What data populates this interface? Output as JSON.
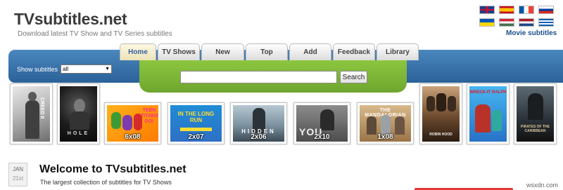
{
  "header": {
    "site_name": "TVsubtitles.net",
    "tagline": "Download latest TV Show and TV Series subtitles",
    "movie_subtitles_link": "Movie subtitles"
  },
  "flags": [
    {
      "name": "uk-flag-icon"
    },
    {
      "name": "spain-flag-icon"
    },
    {
      "name": "france-flag-icon"
    },
    {
      "name": "russia-flag-icon"
    },
    {
      "name": "ukraine-flag-icon"
    },
    {
      "name": "hungary-flag-icon"
    },
    {
      "name": "netherlands-flag-icon"
    },
    {
      "name": "greece-flag-icon"
    }
  ],
  "nav": {
    "tabs": [
      "Home",
      "TV Shows",
      "New",
      "Top",
      "Add",
      "Feedback",
      "Library"
    ],
    "active": "Home",
    "show_subtitles_label": "Show subtitles",
    "show_subtitles_value": "all"
  },
  "search": {
    "button": "Search",
    "value": ""
  },
  "posters": [
    {
      "title": "CREED II",
      "episode": ""
    },
    {
      "title": "HOLE",
      "episode": ""
    },
    {
      "title": "TEEN TITANS GO!",
      "episode": "6x08"
    },
    {
      "title": "IN THE LONG RUN",
      "episode": "2x07"
    },
    {
      "title": "HIDDEN",
      "episode": "2x06"
    },
    {
      "title": "YOU",
      "episode": "2x10"
    },
    {
      "title": "THE MANDALORIAN",
      "episode": "1x08"
    },
    {
      "title": "ROBIN HOOD",
      "episode": ""
    },
    {
      "title": "WRECK-IT RALPH",
      "episode": ""
    },
    {
      "title": "PIRATES OF THE CARIBBEAN",
      "episode": ""
    }
  ],
  "welcome": {
    "month": "JAN",
    "day": "21st",
    "title": "Welcome to TVsubtitles.net",
    "subtitle": "The largest collection of subtitles for TV Shows"
  },
  "watermark": "wsxdn.com",
  "colors": {
    "nav_blue": "#2b6199",
    "search_green": "#7cb534",
    "link_blue": "#1d4f8c"
  }
}
